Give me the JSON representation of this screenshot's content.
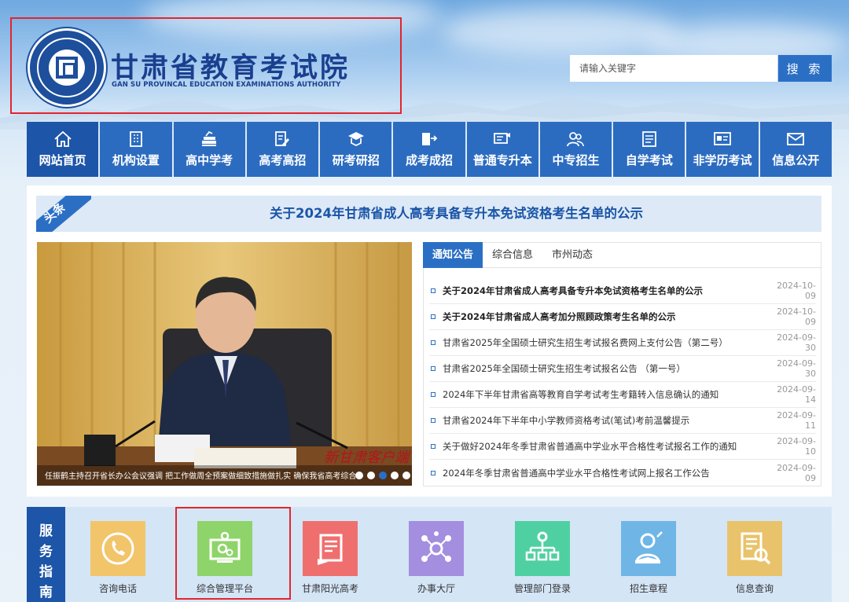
{
  "header": {
    "site_title": "甘肃省教育考试院",
    "site_subtitle": "GAN SU PROVINCAL EDUCATION EXAMINATIONS AUTHORITY",
    "seal_text": "甘肃省教育考试院 GANSU PROVINCIAL EDUCATION EXAMINATIONS AUTHORITY"
  },
  "search": {
    "placeholder": "请输入关键字",
    "button_label": "搜 索"
  },
  "nav": {
    "items": [
      {
        "label": "网站首页",
        "icon": "home-icon",
        "active": true
      },
      {
        "label": "机构设置",
        "icon": "building-icon"
      },
      {
        "label": "高中学考",
        "icon": "books-icon"
      },
      {
        "label": "高考高招",
        "icon": "pencil-paper-icon"
      },
      {
        "label": "研考研招",
        "icon": "graduation-cap-icon"
      },
      {
        "label": "成考成招",
        "icon": "book-arrow-icon"
      },
      {
        "label": "普通专升本",
        "icon": "certificate-icon"
      },
      {
        "label": "中专招生",
        "icon": "people-icon"
      },
      {
        "label": "自学考试",
        "icon": "document-icon"
      },
      {
        "label": "非学历考试",
        "icon": "id-card-icon"
      },
      {
        "label": "信息公开",
        "icon": "mail-icon"
      }
    ]
  },
  "headline": {
    "tag": "头条",
    "text": "关于2024年甘肃省成人高考具备专升本免试资格考生名单的公示"
  },
  "slider": {
    "caption": "任振鹤主持召开省长办公会议强调 把工作做周全预案做细致措施做扎实 确保我省高考综合改革",
    "watermark": "新甘肃客户端",
    "dots": 5,
    "active_dot": 2
  },
  "news": {
    "tabs": [
      {
        "label": "通知公告",
        "active": true
      },
      {
        "label": "综合信息"
      },
      {
        "label": "市州动态"
      }
    ],
    "items": [
      {
        "title": "关于2024年甘肃省成人高考具备专升本免试资格考生名单的公示",
        "date": "2024-10-09",
        "bold": true
      },
      {
        "title": "关于2024年甘肃省成人高考加分照顾政策考生名单的公示",
        "date": "2024-10-09",
        "bold": true
      },
      {
        "title": "甘肃省2025年全国硕士研究生招生考试报名费网上支付公告（第二号）",
        "date": "2024-09-30"
      },
      {
        "title": "甘肃省2025年全国硕士研究生招生考试报名公告 （第一号）",
        "date": "2024-09-30"
      },
      {
        "title": "2024年下半年甘肃省高等教育自学考试考生考籍转入信息确认的通知",
        "date": "2024-09-14"
      },
      {
        "title": "甘肃省2024年下半年中小学教师资格考试(笔试)考前温馨提示",
        "date": "2024-09-11"
      },
      {
        "title": "关于做好2024年冬季甘肃省普通高中学业水平合格性考试报名工作的通知",
        "date": "2024-09-10"
      },
      {
        "title": "2024年冬季甘肃省普通高中学业水平合格性考试网上报名工作公告",
        "date": "2024-09-09"
      }
    ]
  },
  "services": {
    "heading": "服务指南",
    "items": [
      {
        "label": "咨询电话",
        "icon": "phone-icon",
        "color": "#f2c56a"
      },
      {
        "label": "综合管理平台",
        "icon": "computer-gear-icon",
        "color": "#8fd46a"
      },
      {
        "label": "甘肃阳光高考",
        "icon": "form-icon",
        "color": "#ef6f6f"
      },
      {
        "label": "办事大厅",
        "icon": "network-person-icon",
        "color": "#a48ee0"
      },
      {
        "label": "管理部门登录",
        "icon": "org-chart-icon",
        "color": "#4fd0a2"
      },
      {
        "label": "招生章程",
        "icon": "reading-person-icon",
        "color": "#6fb6e6"
      },
      {
        "label": "信息查询",
        "icon": "doc-search-icon",
        "color": "#e9c36b"
      }
    ]
  },
  "colors": {
    "brand_blue": "#2b6fc5",
    "nav_active": "#1d55a8",
    "highlight_red": "#e4252c"
  }
}
